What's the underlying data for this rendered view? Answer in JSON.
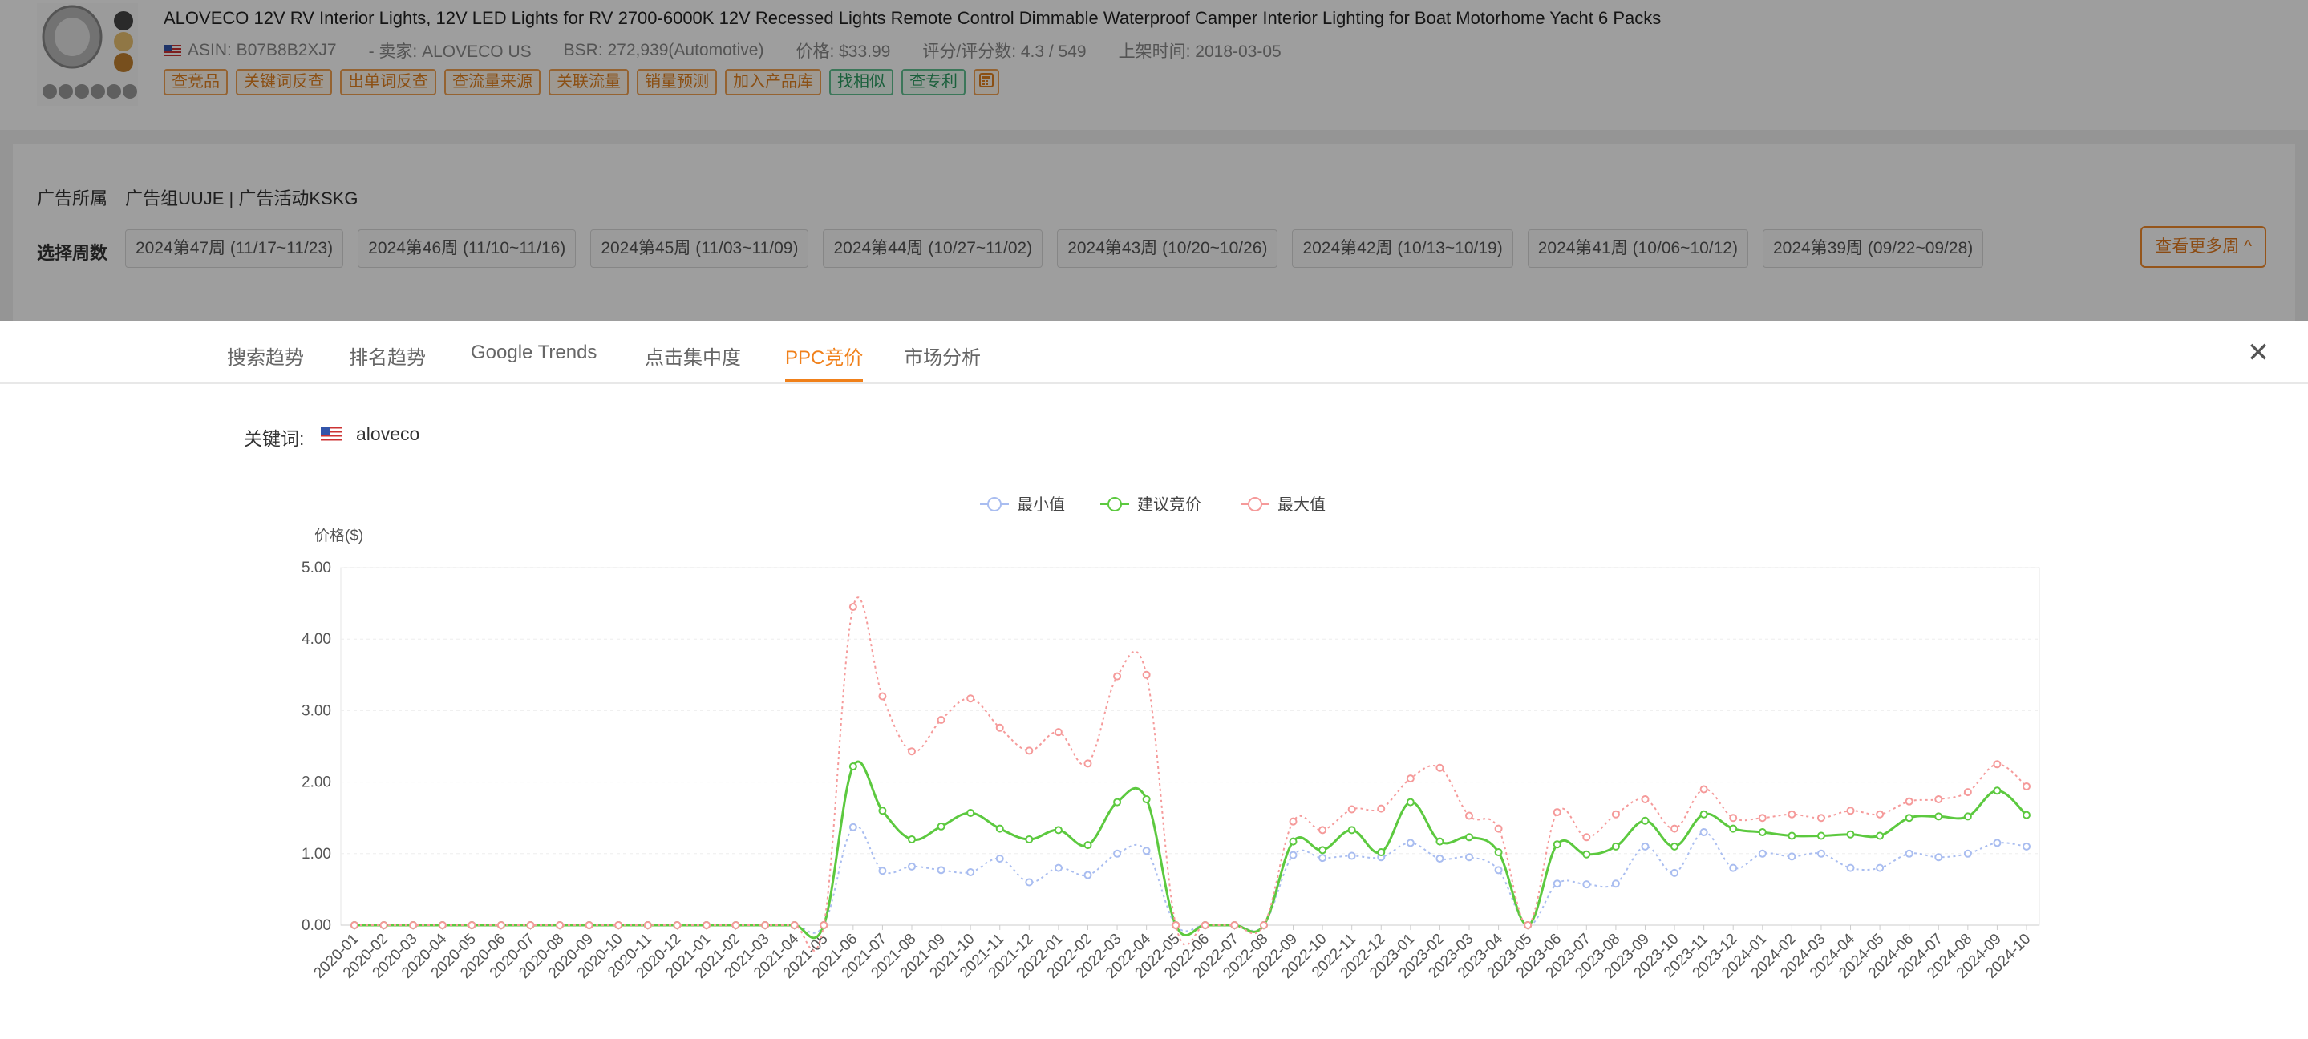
{
  "product": {
    "title": "ALOVECO 12V RV Interior Lights, 12V LED Lights for RV 2700-6000K 12V Recessed Lights Remote Control Dimmable Waterproof Camper Interior Lighting for Boat Motorhome Yacht 6 Packs",
    "asin": "ASIN: B07B8B2XJ7",
    "seller": "- 卖家: ALOVECO US",
    "bsr": "BSR: 272,939(Automotive)",
    "price": "价格: $33.99",
    "rating": "评分/评分数: 4.3 / 549",
    "launch": "上架时间: 2018-03-05",
    "tags": [
      "查竞品",
      "关键词反查",
      "出单词反查",
      "查流量来源",
      "关联流量",
      "销量预测",
      "加入产品库"
    ],
    "green_tags": [
      "找相似",
      "查专利"
    ]
  },
  "ad": {
    "label": "广告所属",
    "value": "广告组UUJE | 广告活动KSKG",
    "week_label": "选择周数",
    "weeks": [
      "2024第47周 (11/17~11/23)",
      "2024第46周 (11/10~11/16)",
      "2024第45周 (11/03~11/09)",
      "2024第44周 (10/27~11/02)",
      "2024第43周 (10/20~10/26)",
      "2024第42周 (10/13~10/19)",
      "2024第41周 (10/06~10/12)",
      "2024第39周 (09/22~09/28)"
    ],
    "more_weeks": "查看更多周 ^"
  },
  "tabs": [
    "搜索趋势",
    "排名趋势",
    "Google Trends",
    "点击集中度",
    "PPC竞价",
    "市场分析"
  ],
  "active_tab": 4,
  "close_icon": "close-icon",
  "keyword": {
    "label": "关键词:",
    "value": "aloveco"
  },
  "colors": {
    "accent": "#f0801a",
    "min": "#a9bdf0",
    "suggest": "#5cc93f",
    "max": "#f59a9a"
  },
  "chart_data": {
    "type": "line",
    "ylabel": "价格($)",
    "ylim": [
      0,
      5
    ],
    "yticks": [
      "0.00",
      "1.00",
      "2.00",
      "3.00",
      "4.00",
      "5.00"
    ],
    "grid": true,
    "legend_position": "top-center",
    "x": [
      "2020-01",
      "2020-02",
      "2020-03",
      "2020-04",
      "2020-05",
      "2020-06",
      "2020-07",
      "2020-08",
      "2020-09",
      "2020-10",
      "2020-11",
      "2020-12",
      "2021-01",
      "2021-02",
      "2021-03",
      "2021-04",
      "2021-05",
      "2021-06",
      "2021-07",
      "2021-08",
      "2021-09",
      "2021-10",
      "2021-11",
      "2021-12",
      "2022-01",
      "2022-02",
      "2022-03",
      "2022-04",
      "2022-05",
      "2022-06",
      "2022-07",
      "2022-08",
      "2022-09",
      "2022-10",
      "2022-11",
      "2022-12",
      "2023-01",
      "2023-02",
      "2023-03",
      "2023-04",
      "2023-05",
      "2023-06",
      "2023-07",
      "2023-08",
      "2023-09",
      "2023-10",
      "2023-11",
      "2023-12",
      "2024-01",
      "2024-02",
      "2024-03",
      "2024-04",
      "2024-05",
      "2024-06",
      "2024-07",
      "2024-08",
      "2024-09",
      "2024-10"
    ],
    "series": [
      {
        "name": "最小值",
        "values": [
          0,
          0,
          0,
          0,
          0,
          0,
          0,
          0,
          0,
          0,
          0,
          0,
          0,
          0,
          0,
          0,
          0,
          1.37,
          0.76,
          0.82,
          0.77,
          0.74,
          0.93,
          0.6,
          0.8,
          0.7,
          1.0,
          1.04,
          0,
          0,
          0,
          0,
          0.98,
          0.94,
          0.97,
          0.95,
          1.15,
          0.93,
          0.95,
          0.77,
          0,
          0.58,
          0.57,
          0.58,
          1.1,
          0.73,
          1.3,
          0.8,
          1.0,
          0.96,
          1.0,
          0.8,
          0.8,
          1.0,
          0.95,
          1.0,
          1.15,
          1.1
        ]
      },
      {
        "name": "建议竞价",
        "values": [
          0,
          0,
          0,
          0,
          0,
          0,
          0,
          0,
          0,
          0,
          0,
          0,
          0,
          0,
          0,
          0,
          0,
          2.22,
          1.6,
          1.2,
          1.38,
          1.57,
          1.35,
          1.2,
          1.33,
          1.12,
          1.72,
          1.76,
          0,
          0,
          0,
          0,
          1.17,
          1.05,
          1.33,
          1.02,
          1.72,
          1.17,
          1.23,
          1.02,
          0,
          1.13,
          0.99,
          1.1,
          1.46,
          1.1,
          1.55,
          1.35,
          1.3,
          1.25,
          1.25,
          1.27,
          1.25,
          1.5,
          1.52,
          1.52,
          1.88,
          1.54
        ]
      },
      {
        "name": "最大值",
        "values": [
          0,
          0,
          0,
          0,
          0,
          0,
          0,
          0,
          0,
          0,
          0,
          0,
          0,
          0,
          0,
          0,
          0,
          4.45,
          3.2,
          2.43,
          2.87,
          3.17,
          2.76,
          2.44,
          2.7,
          2.26,
          3.48,
          3.5,
          0,
          0,
          0,
          0,
          1.45,
          1.33,
          1.62,
          1.63,
          2.05,
          2.2,
          1.53,
          1.35,
          0,
          1.58,
          1.23,
          1.55,
          1.76,
          1.35,
          1.9,
          1.5,
          1.5,
          1.55,
          1.5,
          1.6,
          1.55,
          1.73,
          1.76,
          1.86,
          2.25,
          1.94
        ]
      }
    ]
  }
}
